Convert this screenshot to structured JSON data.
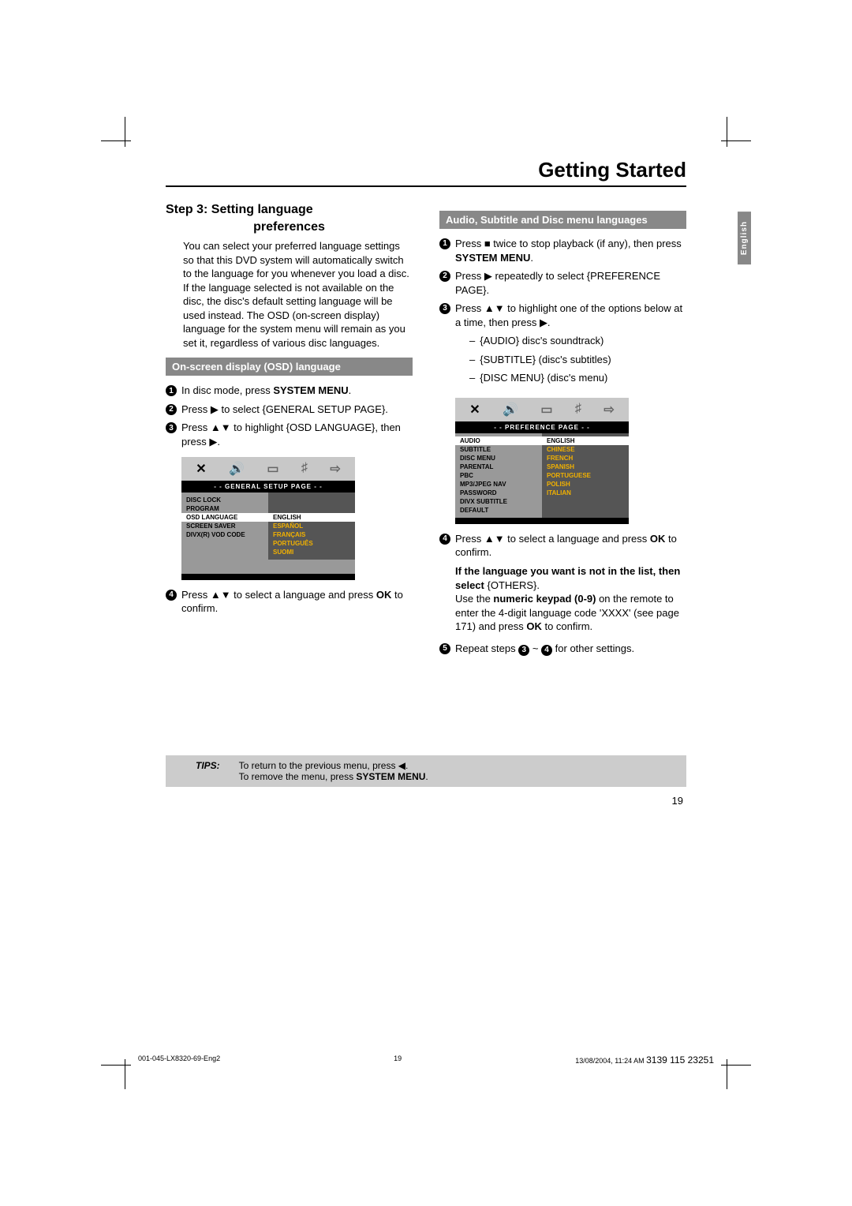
{
  "title": "Getting Started",
  "language_tab": "English",
  "step": {
    "heading": "Step 3:  Setting language",
    "sub": "preferences",
    "intro": "You can select your preferred language settings so that this DVD system will automatically switch to the language for you whenever you load a disc.  If the language selected is not available on the disc, the disc's default setting language will be used instead.  The OSD (on-screen display) language for the system menu will remain as you set it, regardless of various disc languages."
  },
  "osd_section": {
    "bar": "On-screen display (OSD) language",
    "items": {
      "i1a": "In disc mode, press ",
      "i1b": "SYSTEM MENU",
      "i1c": ".",
      "i2a": "Press ▶ to select {GENERAL SETUP PAGE}.",
      "i3a": "Press ▲▼ to highlight {OSD LANGUAGE}, then press ▶.",
      "i4a": "Press ▲▼ to select a language and press ",
      "i4b": "OK",
      "i4c": " to confirm."
    }
  },
  "osd_menu1": {
    "title": "- -   GENERAL  SETUP  PAGE   - -",
    "left": [
      "DISC LOCK",
      "PROGRAM",
      "OSD LANGUAGE",
      "SCREEN SAVER",
      "DIVX(R) VOD CODE"
    ],
    "left_hl_index": 2,
    "right": [
      "ENGLISH",
      "ESPAÑOL",
      "FRANÇAIS",
      "PORTUGUÊS",
      "SUOMI"
    ],
    "right_sel_index": 0
  },
  "audio_section": {
    "bar": "Audio, Subtitle and Disc menu languages",
    "items": {
      "i1a": "Press  ■  twice to stop playback (if any), then press ",
      "i1b": "SYSTEM MENU",
      "i1c": ".",
      "i2a": "Press ▶ repeatedly to select {PREFERENCE PAGE}.",
      "i3a": "Press ▲▼  to highlight one of the options below at a time, then press ▶.",
      "i3_opts": [
        "{AUDIO} disc's soundtrack)",
        "{SUBTITLE} (disc's subtitles)",
        "{DISC MENU} (disc's menu)"
      ],
      "i4a": "Press ▲▼  to select a language and press ",
      "i4b": "OK",
      "i4c": " to confirm.",
      "noteBold1": "If the language you want is not in the list, then select ",
      "noteBold2": "{OTHERS}.",
      "noteText": "Use the numeric keypad (0-9) on the remote to enter the 4-digit language code 'XXXX' (see page 171) and press OK to confirm.",
      "i5a": "Repeat steps ",
      "i5b": " ~ ",
      "i5c": " for other settings."
    }
  },
  "osd_menu2": {
    "title": "- -   PREFERENCE  PAGE   - -",
    "left": [
      "AUDIO",
      "SUBTITLE",
      "DISC MENU",
      "PARENTAL",
      "PBC",
      "MP3/JPEG NAV",
      "PASSWORD",
      "DIVX SUBTITLE",
      "DEFAULT"
    ],
    "left_hl_index": 0,
    "right": [
      "ENGLISH",
      "CHINESE",
      "FRENCH",
      "SPANISH",
      "PORTUGUESE",
      "POLISH",
      "ITALIAN"
    ],
    "right_sel_index": 0
  },
  "tips": {
    "label": "TIPS:",
    "line1": "To return to the previous menu, press ◀.",
    "line2a": "To remove the menu, press ",
    "line2b": "SYSTEM MENU",
    "line2c": "."
  },
  "page_number": "19",
  "footer": {
    "left": "001-045-LX8320-69-Eng2",
    "center": "19",
    "right_small": "13/08/2004, 11:24 AM",
    "right_big": "3139 115 23251"
  }
}
